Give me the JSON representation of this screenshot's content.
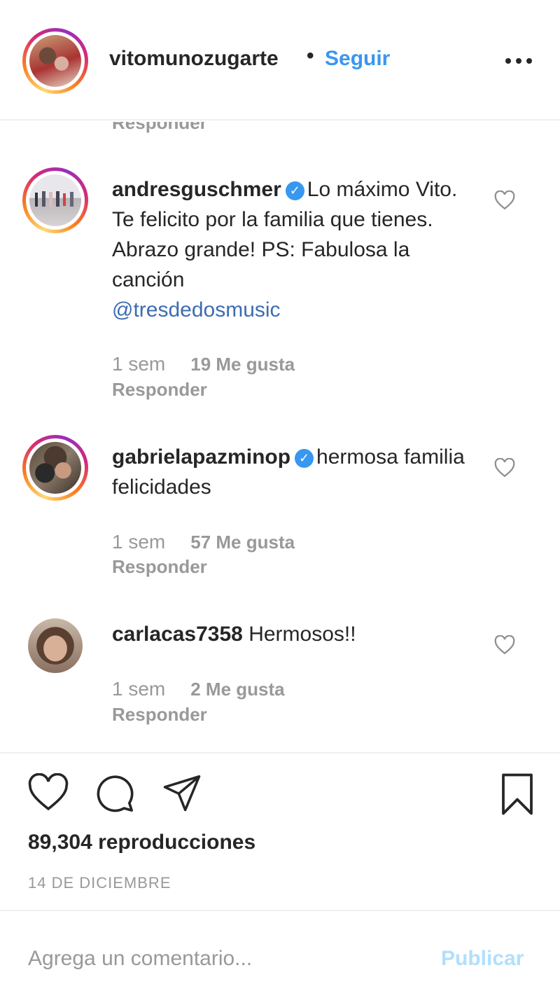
{
  "header": {
    "username": "vitomunozugarte",
    "separator": "•",
    "follow_label": "Seguir",
    "more_icon": "more-horizontal-icon"
  },
  "cut_reply_label": "Responder",
  "comments": [
    {
      "username": "andresguschmer",
      "verified": true,
      "text": "Lo máximo Vito. Te felicito por la familia que tienes. Abrazo grande! PS: Fabulosa la canción",
      "mention": "@tresdedosmusic",
      "time": "1 sem",
      "likes": "19 Me gusta",
      "reply": "Responder"
    },
    {
      "username": "gabrielapazminop",
      "verified": true,
      "text": "hermosa familia felicidades",
      "time": "1 sem",
      "likes": "57 Me gusta",
      "reply": "Responder"
    },
    {
      "username": "carlacas7358",
      "verified": false,
      "text": "Hermosos!!",
      "time": "1 sem",
      "likes": "2 Me gusta",
      "reply": "Responder"
    }
  ],
  "actions": {
    "like_icon": "heart-icon",
    "comment_icon": "comment-icon",
    "share_icon": "send-icon",
    "save_icon": "bookmark-icon"
  },
  "views": "89,304 reproducciones",
  "date": "14 DE DICIEMBRE",
  "comment_box": {
    "placeholder": "Agrega un comentario...",
    "publish_label": "Publicar"
  },
  "colors": {
    "accent": "#3897f0",
    "publish_disabled": "#b2dffc",
    "muted": "#999999",
    "text": "#262626"
  }
}
